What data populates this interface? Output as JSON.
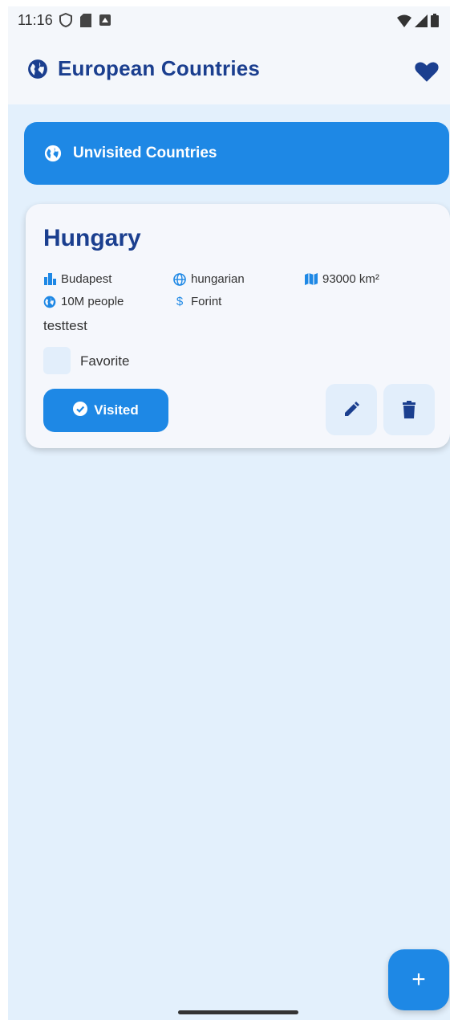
{
  "status_bar": {
    "time": "11:16",
    "icons_left": [
      "shield-icon",
      "sd-card-icon",
      "notification-icon"
    ],
    "icons_right": [
      "wifi-icon",
      "signal-icon",
      "battery-icon"
    ]
  },
  "app_bar": {
    "title": "European Countries",
    "icon": "globe-icon",
    "action_icon": "heart-icon"
  },
  "filter": {
    "label": "Unvisited Countries",
    "icon": "globe-icon"
  },
  "country_card": {
    "name": "Hungary",
    "facts": {
      "capital": "Budapest",
      "language": "hungarian",
      "area": "93000 km²",
      "population": "10M people",
      "currency": "Forint"
    },
    "notes": "testtest",
    "favorite_label": "Favorite",
    "favorite_checked": false,
    "visited_label": "Visited"
  },
  "fab": {
    "label": "+"
  },
  "colors": {
    "primary": "#1e88e5",
    "title": "#1b3f8f",
    "background": "#e3f0fc",
    "surface": "#f5f7fc",
    "tonal": "#e2eefb"
  }
}
